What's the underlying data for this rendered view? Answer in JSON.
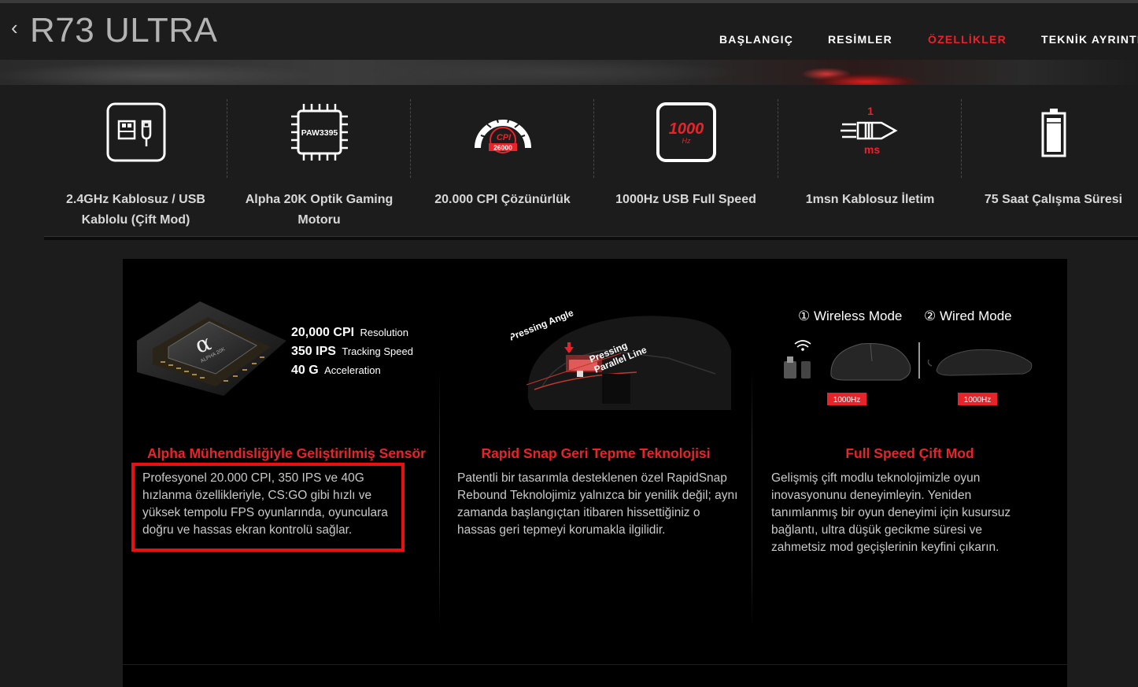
{
  "header": {
    "back_icon": "chevron-left-icon",
    "title": "R73 ULTRA",
    "nav": [
      {
        "label": "BAŞLANGIÇ",
        "active": false
      },
      {
        "label": "RESİMLER",
        "active": false
      },
      {
        "label": "ÖZELLİKLER",
        "active": true
      },
      {
        "label": "TEKNİK AYRINTI",
        "active": false
      }
    ]
  },
  "features": [
    {
      "icon": "usb-wireless-icon",
      "label": "2.4GHz Kablosuz / USB Kablolu (Çift Mod)"
    },
    {
      "icon": "chip-icon",
      "chip_text": "PAW3395",
      "label": "Alpha 20K Optik Gaming Motoru"
    },
    {
      "icon": "cpi-gauge-icon",
      "gauge_top": "CPI",
      "gauge_value": "26000",
      "label": "20.000 CPI Çözünürlük"
    },
    {
      "icon": "polling-rate-icon",
      "rate_value": "1000",
      "rate_unit": "Hz",
      "label": "1000Hz USB Full Speed"
    },
    {
      "icon": "latency-bullet-icon",
      "latency_value": "1",
      "latency_unit": "ms",
      "label": "1msn Kablosuz İletim"
    },
    {
      "icon": "battery-icon",
      "label": "75 Saat Çalışma Süresi"
    }
  ],
  "columns": [
    {
      "image": {
        "chip_brand": "ALPHA 20K",
        "specs": [
          {
            "value": "20,000 CPI",
            "unit": "Resolution"
          },
          {
            "value": "350 IPS",
            "unit": "Tracking Speed"
          },
          {
            "value": "40 G",
            "unit": "Acceleration"
          }
        ]
      },
      "title": "Alpha Mühendisliğiyle Geliştirilmiş Sensör",
      "text": "Profesyonel 20.000 CPI, 350 IPS ve 40G hızlanma özellikleriyle, CS:GO gibi hızlı ve yüksek tempolu FPS oyunlarında, oyunculara doğru ve hassas ekran kontrolü sağlar."
    },
    {
      "image": {
        "label_angle": "Pressing Angle",
        "label_parallel_1": "Pressing",
        "label_parallel_2": "Parallel Line"
      },
      "title": "Rapid Snap Geri Tepme Teknolojisi",
      "text": "Patentli bir tasarımla desteklenen özel RapidSnap Rebound Teknolojimiz yalnızca bir yenilik değil; aynı zamanda başlangıçtan itibaren hissettiğiniz o hassas geri tepmeyi korumakla ilgilidir."
    },
    {
      "image": {
        "mode1": "① Wireless Mode",
        "mode2": "② Wired Mode",
        "rate1": "1000Hz",
        "rate2": "1000Hz"
      },
      "title": "Full Speed Çift Mod",
      "text": "Gelişmiş çift modlu teknolojimizle oyun inovasyonunu deneyimleyin. Yeniden tanımlanmış bir oyun deneyimi için kusursuz bağlantı, ultra düşük gecikme süresi ve zahmetsiz mod geçişlerinin keyfini çıkarın."
    }
  ],
  "colors": {
    "accent": "#e8242a",
    "highlight": "#e81010",
    "background": "#1c1c1c",
    "panel": "#000000"
  }
}
